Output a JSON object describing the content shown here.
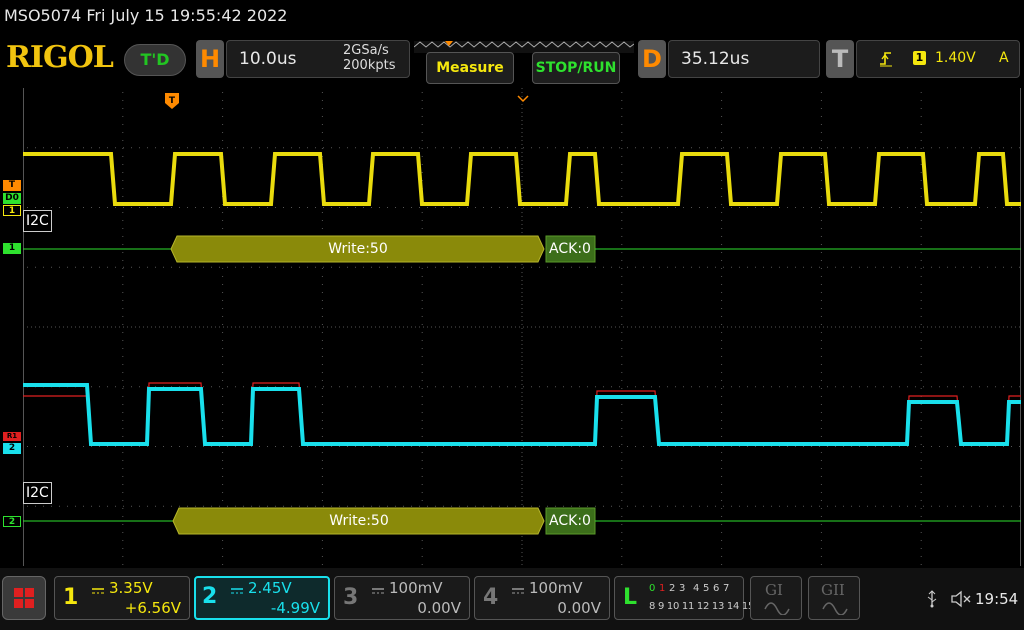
{
  "titlebar": {
    "text": "MSO5074  Fri July 15 19:55:42 2022"
  },
  "header": {
    "logo": "RIGOL",
    "trigger_status": "T'D",
    "horizontal": {
      "letter": "H",
      "timebase": "10.0us",
      "sample_rate": "2GSa/s",
      "memory_depth": "200kpts"
    },
    "measure_label": "Measure",
    "stop_run_label": "STOP/RUN",
    "delay": {
      "letter": "D",
      "value": "35.12us"
    },
    "trigger": {
      "letter": "T",
      "source": "1",
      "level": "1.40V",
      "mode": "A"
    }
  },
  "waveforms": {
    "ch1": {
      "color": "#f5e70e",
      "marker": "1",
      "t_marker": "T",
      "d0_marker": "D0"
    },
    "ch2": {
      "color": "#19e0ec",
      "marker": "2",
      "ref_marker": "R1"
    },
    "decode1": {
      "label": "I2C",
      "marker": "1",
      "packet_text": "Write:50",
      "ack_text": "ACK:0",
      "color": "#2ee12e"
    },
    "decode2": {
      "label": "I2C",
      "marker": "2",
      "packet_text": "Write:50",
      "ack_text": "ACK:0",
      "color": "#2ee12e"
    }
  },
  "bottom": {
    "ch1": {
      "num": "1",
      "scale": "3.35V",
      "offset": "+6.56V"
    },
    "ch2": {
      "num": "2",
      "scale": "2.45V",
      "offset": "-4.99V"
    },
    "ch3": {
      "num": "3",
      "scale": "100mV",
      "offset": "0.00V"
    },
    "ch4": {
      "num": "4",
      "scale": "100mV",
      "offset": "0.00V"
    },
    "logic": {
      "letter": "L",
      "row1_active": [
        "0",
        "1"
      ],
      "row1_rest": [
        "2",
        "3",
        "4",
        "5",
        "6",
        "7"
      ],
      "row2": "8 9 10 11 12 13 14 15"
    },
    "g1": "GI",
    "g2": "GII",
    "clock": "19:54"
  }
}
